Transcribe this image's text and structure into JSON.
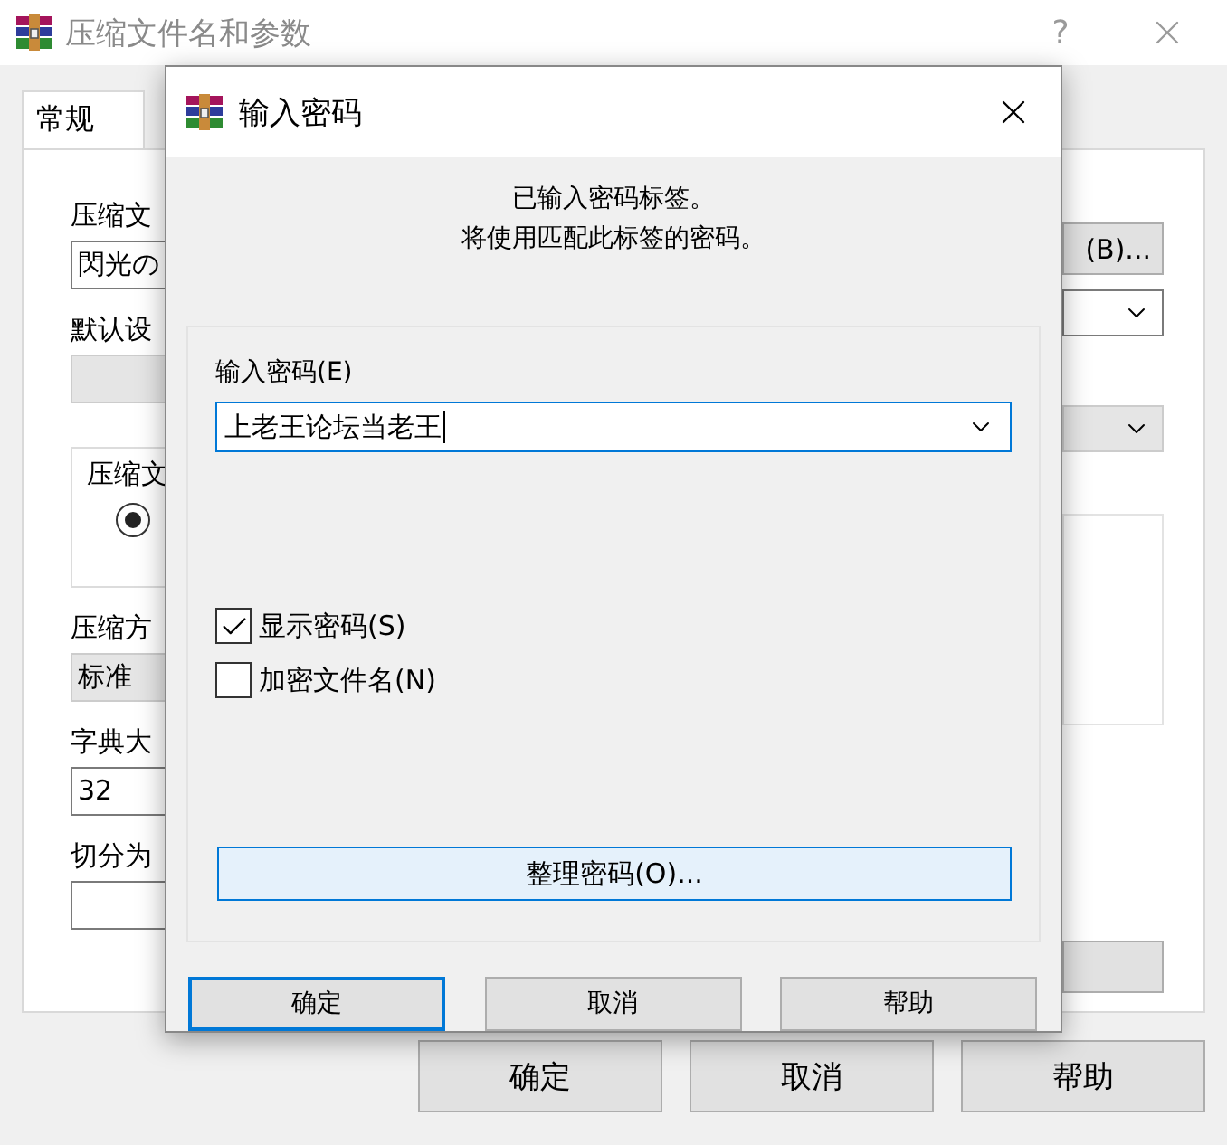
{
  "main_window": {
    "title": "压缩文件名和参数",
    "help_glyph": "?"
  },
  "tabs": [
    {
      "label": "常规",
      "selected": true
    }
  ],
  "left_column": [
    {
      "kind": "label",
      "text": "压缩文"
    },
    {
      "kind": "field",
      "value": "閃光の"
    },
    {
      "kind": "label",
      "text": "默认设"
    },
    {
      "kind": "combo",
      "disabled": true
    },
    {
      "kind": "group",
      "legend": "压缩文",
      "radio_selected": true
    },
    {
      "kind": "label",
      "text": "压缩方"
    },
    {
      "kind": "combo",
      "value": "标准",
      "disabled": true
    },
    {
      "kind": "label",
      "text": "字典大"
    },
    {
      "kind": "field",
      "value": "32"
    },
    {
      "kind": "label",
      "text": "切分为"
    },
    {
      "kind": "field"
    }
  ],
  "right_column": [
    {
      "kind": "button",
      "label": "(B)..."
    },
    {
      "kind": "combo",
      "disabled": false
    },
    {
      "kind": "combo",
      "disabled": true
    },
    {
      "kind": "panel"
    },
    {
      "kind": "button"
    }
  ],
  "buttons": [
    "确定",
    "取消",
    "帮助"
  ],
  "dialog": {
    "title": "输入密码",
    "message": [
      "已输入密码标签。",
      "将使用匹配此标签的密码。"
    ],
    "password_label": "输入密码(E)",
    "password_value": "上老王论坛当老王",
    "options": [
      {
        "label": "显示密码(S)",
        "checked": true
      },
      {
        "label": "加密文件名(N)",
        "checked": false
      }
    ],
    "organize_button": "整理密码(O)...",
    "buttons": [
      {
        "label": "确定",
        "default": true
      },
      {
        "label": "取消",
        "default": false
      },
      {
        "label": "帮助",
        "default": false
      }
    ]
  }
}
